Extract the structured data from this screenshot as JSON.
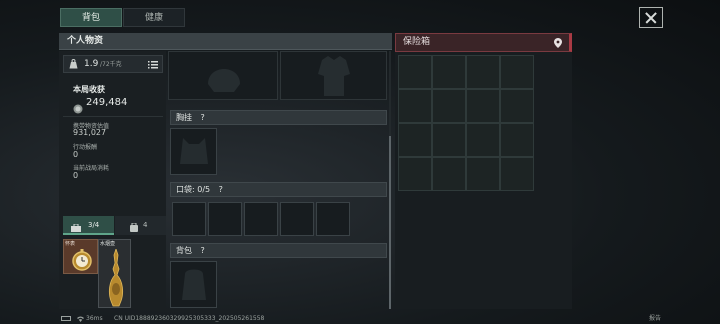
{
  "tabs": [
    {
      "label": "背包"
    },
    {
      "label": "健康"
    }
  ],
  "personal": {
    "title": "个人物资",
    "weight": "1.9",
    "weight_max": "/72千克",
    "round_income_label": "本局收获",
    "round_income_value": "249,484",
    "stats": [
      {
        "label": "携带物资估值",
        "value": "931,027"
      },
      {
        "label": "行动报酬",
        "value": "0"
      },
      {
        "label": "当前战局消耗",
        "value": "0"
      }
    ],
    "bottom_tabs": [
      {
        "label": "3/4"
      },
      {
        "label": "4"
      }
    ],
    "items": [
      {
        "label": "怀表"
      },
      {
        "label": "水烟壶"
      }
    ]
  },
  "sections": {
    "chest_rig": "胸挂",
    "pockets": "口袋: 0/5",
    "backpack": "背包",
    "help_glyph": "?"
  },
  "safe_box": {
    "title": "保险箱"
  },
  "status": {
    "ping": "36ms",
    "uid": "CN UID188892360329925305333_202505261558",
    "corner": "报告"
  },
  "colors": {
    "accent_green": "#2f4f47",
    "safe_red": "#a93a44",
    "item_gold": "#b88a2e"
  }
}
